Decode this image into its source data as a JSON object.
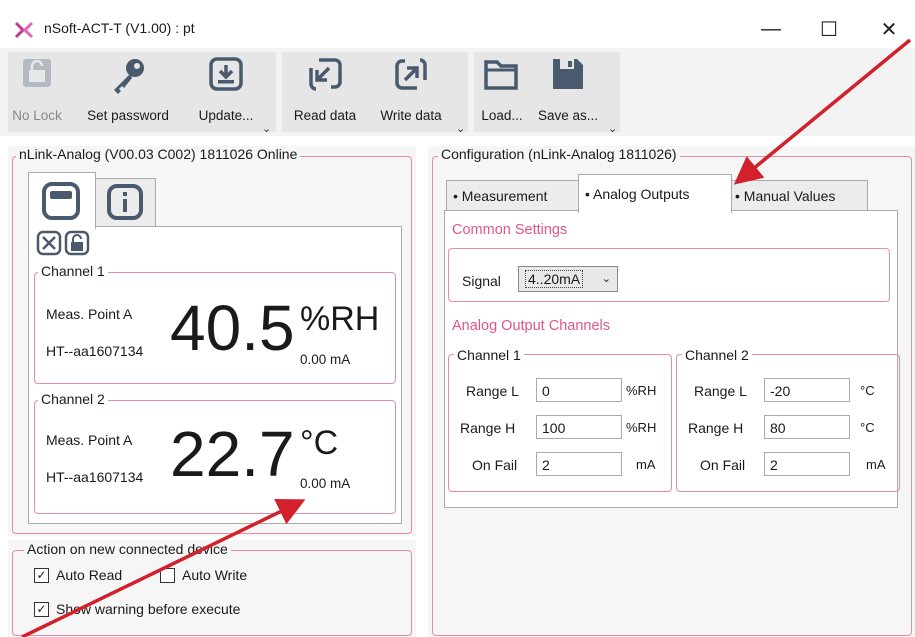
{
  "window": {
    "title": "nSoft-ACT-T (V1.00) : pt",
    "minimize": "—",
    "maximize": "☐",
    "close": "✕"
  },
  "toolbar": {
    "no_lock": "No Lock",
    "set_password": "Set password",
    "update": "Update...",
    "read_data": "Read data",
    "write_data": "Write data",
    "load": "Load...",
    "save_as": "Save as...",
    "more": "⌄"
  },
  "device_panel": {
    "title": "nLink-Analog (V00.03 C002) 1811026 Online",
    "channels": [
      {
        "title": "Channel 1",
        "point": "Meas. Point A",
        "sensor": "HT--aa1607134",
        "value": "40.5",
        "unit": "%RH",
        "current": "0.00 mA"
      },
      {
        "title": "Channel 2",
        "point": "Meas. Point A",
        "sensor": "HT--aa1607134",
        "value": "22.7",
        "unit": "°C",
        "current": "0.00 mA"
      }
    ]
  },
  "action_panel": {
    "title": "Action on new connected device",
    "auto_read": "Auto Read",
    "auto_read_checked": true,
    "auto_write": "Auto Write",
    "auto_write_checked": false,
    "show_warning": "Show warning before execute",
    "show_warning_checked": true
  },
  "config_panel": {
    "title": "Configuration (nLink-Analog 1811026)",
    "tabs": [
      "• Measurement",
      "• Analog Outputs",
      "• Manual Values"
    ],
    "active_tab": "• Analog Outputs",
    "common_settings": "Common Settings",
    "signal_label": "Signal",
    "signal_value": "4..20mA",
    "outputs_heading": "Analog Output Channels",
    "range_l": "Range L",
    "range_h": "Range H",
    "on_fail": "On Fail",
    "channels": [
      {
        "title": "Channel 1",
        "range_l": "0",
        "range_h": "100",
        "on_fail": "2",
        "unit": "%RH",
        "fail_unit": "mA"
      },
      {
        "title": "Channel 2",
        "range_l": "-20",
        "range_h": "80",
        "on_fail": "2",
        "unit": "°C",
        "fail_unit": "mA"
      }
    ]
  },
  "colors": {
    "accent_pink": "#e0568a",
    "arrow_red": "#d2202c",
    "icon_slate": "#4a5a6e"
  }
}
